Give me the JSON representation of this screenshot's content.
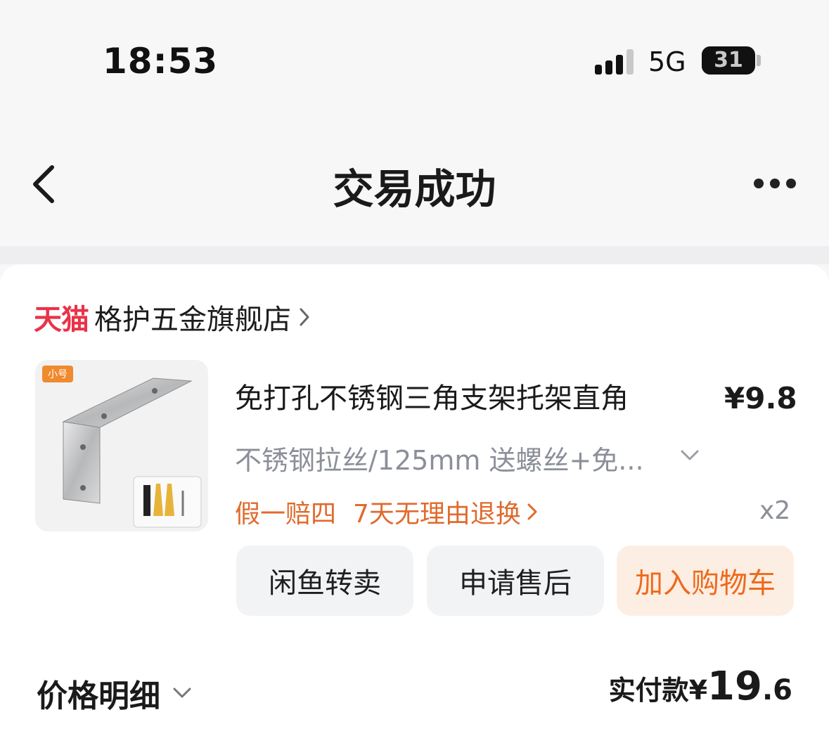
{
  "status_bar": {
    "time": "18:53",
    "network": "5G",
    "battery": "31",
    "battery_level": 0.31
  },
  "nav": {
    "title": "交易成功"
  },
  "store": {
    "platform_logo": "天猫",
    "name": "格护五金旗舰店"
  },
  "product": {
    "thumb_tag": "小号",
    "title": "免打孔不锈钢三角支架托架直角",
    "price": "¥9.8",
    "spec": "不锈钢拉丝/125mm 送螺丝+免...",
    "guarantee_1": "假一赔四",
    "guarantee_2": "7天无理由退换",
    "quantity": "x2"
  },
  "actions": {
    "resell": "闲鱼转卖",
    "after_sales": "申请售后",
    "add_to_cart": "加入购物车"
  },
  "summary": {
    "price_detail_label": "价格明细",
    "paid_label": "实付款",
    "paid_currency": "¥",
    "paid_integer": "19",
    "paid_decimal": ".6"
  },
  "colors": {
    "tmall_red": "#e8334a",
    "accent_orange": "#ee6a1c",
    "guarantee_orange": "#e06a2c"
  },
  "icons": [
    "back-chevron-icon",
    "more-dots-icon",
    "chevron-right-icon",
    "chevron-down-icon"
  ]
}
